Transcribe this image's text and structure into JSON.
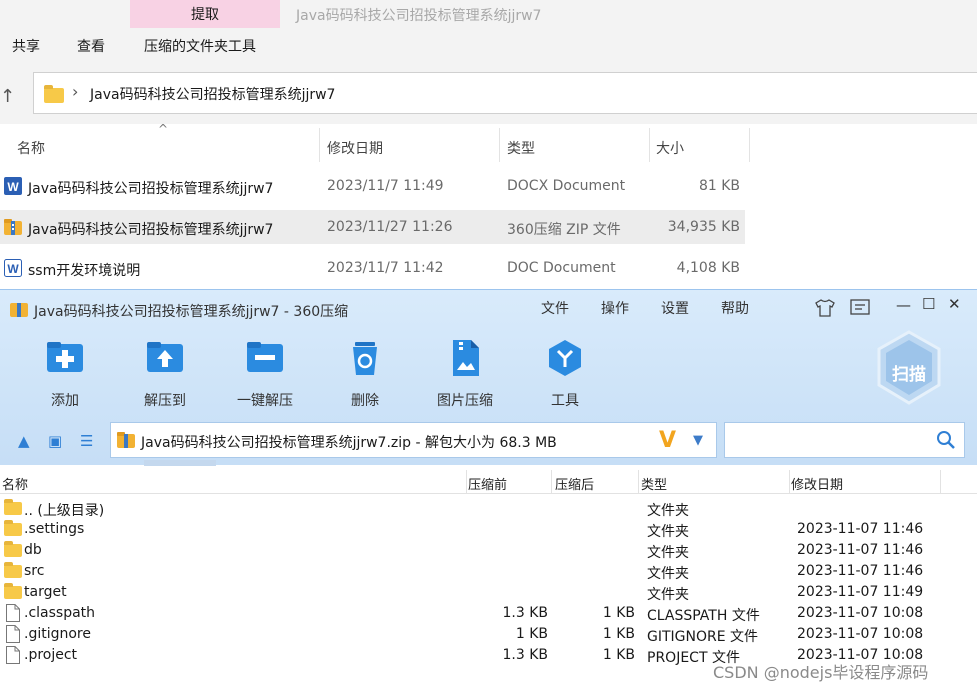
{
  "explorer": {
    "tab_label": "提取",
    "window_title": "Java码码科技公司招投标管理系统jjrw7",
    "ribbon": [
      "共享",
      "查看",
      "压缩的文件夹工具"
    ],
    "address_path": "Java码码科技公司招投标管理系统jjrw7",
    "columns": {
      "name": "名称",
      "date": "修改日期",
      "type": "类型",
      "size": "大小"
    },
    "files": [
      {
        "name": "Java码码科技公司招投标管理系统jjrw7",
        "date": "2023/11/7 11:49",
        "type": "DOCX Document",
        "size": "81 KB",
        "icon": "word-doc-icon"
      },
      {
        "name": "Java码码科技公司招投标管理系统jjrw7",
        "date": "2023/11/27 11:26",
        "type": "360压缩 ZIP 文件",
        "size": "34,935 KB",
        "icon": "zip-archive-icon"
      },
      {
        "name": "ssm开发环境说明",
        "date": "2023/11/7 11:42",
        "type": "DOC Document",
        "size": "4,108 KB",
        "icon": "word-doc-icon"
      }
    ]
  },
  "zip": {
    "title": "Java码码科技公司招投标管理系统jjrw7 - 360压缩",
    "menu": [
      "文件",
      "操作",
      "设置",
      "帮助"
    ],
    "toolbar": [
      {
        "label": "添加",
        "icon": "add-icon"
      },
      {
        "label": "解压到",
        "icon": "extract-to-icon"
      },
      {
        "label": "一键解压",
        "icon": "one-click-extract-icon"
      },
      {
        "label": "删除",
        "icon": "recycle-bin-icon"
      },
      {
        "label": "图片压缩",
        "icon": "image-compress-icon"
      },
      {
        "label": "工具",
        "icon": "tools-icon"
      }
    ],
    "scan_label": "扫描",
    "address": "Java码码科技公司招投标管理系统jjrw7.zip - 解包大小为 68.3 MB",
    "vlogo": "V",
    "columns": {
      "name": "名称",
      "before": "压缩前",
      "after": "压缩后",
      "type": "类型",
      "date": "修改日期"
    },
    "entries": [
      {
        "name": ".. (上级目录)",
        "before": "",
        "after": "",
        "type": "文件夹",
        "date": "",
        "kind": "folder"
      },
      {
        "name": ".settings",
        "before": "",
        "after": "",
        "type": "文件夹",
        "date": "2023-11-07 11:46",
        "kind": "folder"
      },
      {
        "name": "db",
        "before": "",
        "after": "",
        "type": "文件夹",
        "date": "2023-11-07 11:46",
        "kind": "folder"
      },
      {
        "name": "src",
        "before": "",
        "after": "",
        "type": "文件夹",
        "date": "2023-11-07 11:46",
        "kind": "folder"
      },
      {
        "name": "target",
        "before": "",
        "after": "",
        "type": "文件夹",
        "date": "2023-11-07 11:49",
        "kind": "folder"
      },
      {
        "name": ".classpath",
        "before": "1.3 KB",
        "after": "1 KB",
        "type": "CLASSPATH 文件",
        "date": "2023-11-07 10:08",
        "kind": "file"
      },
      {
        "name": ".gitignore",
        "before": "1 KB",
        "after": "1 KB",
        "type": "GITIGNORE 文件",
        "date": "2023-11-07 10:08",
        "kind": "file"
      },
      {
        "name": ".project",
        "before": "1.3 KB",
        "after": "1 KB",
        "type": "PROJECT 文件",
        "date": "2023-11-07 10:08",
        "kind": "file"
      }
    ]
  },
  "watermark": "CSDN @nodejs毕设程序源码"
}
